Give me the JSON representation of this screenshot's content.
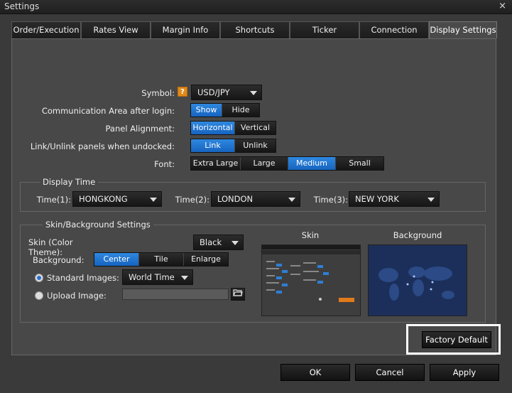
{
  "window": {
    "title": "Settings",
    "close_glyph": "×"
  },
  "tabs": [
    {
      "label": "Order/Execution"
    },
    {
      "label": "Rates View"
    },
    {
      "label": "Margin Info"
    },
    {
      "label": "Shortcuts"
    },
    {
      "label": "Ticker"
    },
    {
      "label": "Connection"
    },
    {
      "label": "Display Settings",
      "active": true
    }
  ],
  "settings": {
    "symbol": {
      "label": "Symbol:",
      "value": "USD/JPY",
      "help_glyph": "?"
    },
    "comm_area": {
      "label": "Communication Area after login:",
      "options": [
        "Show",
        "Hide"
      ],
      "selected": "Show"
    },
    "panel_alignment": {
      "label": "Panel Alignment:",
      "options": [
        "Horizontal",
        "Vertical"
      ],
      "selected": "Horizontal"
    },
    "link_unlink": {
      "label": "Link/Unlink panels when undocked:",
      "options": [
        "Link",
        "Unlink"
      ],
      "selected": "Link"
    },
    "font": {
      "label": "Font:",
      "options": [
        "Extra Large",
        "Large",
        "Medium",
        "Small"
      ],
      "selected": "Medium"
    }
  },
  "display_time": {
    "title": "Display Time",
    "time1": {
      "label": "Time(1):",
      "value": "HONGKONG"
    },
    "time2": {
      "label": "Time(2):",
      "value": "LONDON"
    },
    "time3": {
      "label": "Time(3):",
      "value": "NEW YORK"
    }
  },
  "skin": {
    "title": "Skin/Background Settings",
    "theme": {
      "label": "Skin (Color Theme):",
      "value": "Black"
    },
    "background": {
      "label": "Background:",
      "options": [
        "Center",
        "Tile",
        "Enlarge"
      ],
      "selected": "Center"
    },
    "standard_images": {
      "label": "Standard Images:",
      "value": "World Time",
      "checked": true
    },
    "upload_image": {
      "label": "Upload Image:",
      "value": ""
    },
    "preview_skin_label": "Skin",
    "preview_bg_label": "Background"
  },
  "buttons": {
    "factory_default": "Factory Default",
    "ok": "OK",
    "cancel": "Cancel",
    "apply": "Apply"
  },
  "colors": {
    "accent": "#1f78d8",
    "help_icon": "#e08a1a",
    "highlight_box": "#ffffff"
  }
}
